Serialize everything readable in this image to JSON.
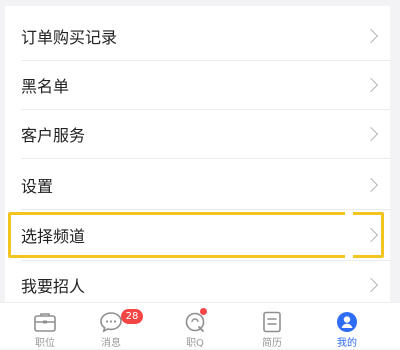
{
  "menu": {
    "items": [
      {
        "label": "订单购买记录"
      },
      {
        "label": "黑名单"
      },
      {
        "label": "客户服务"
      },
      {
        "label": "设置"
      },
      {
        "label": "选择频道"
      },
      {
        "label": "我要招人"
      }
    ]
  },
  "tabbar": {
    "tabs": [
      {
        "label": "职位",
        "icon": "briefcase-icon"
      },
      {
        "label": "消息",
        "icon": "chat-bubble-icon"
      },
      {
        "label": "职Q",
        "icon": "q-bubble-icon"
      },
      {
        "label": "简历",
        "icon": "resume-icon"
      },
      {
        "label": "我的",
        "icon": "user-avatar-icon"
      }
    ],
    "message_badge": "28",
    "active_tab": "我的"
  },
  "colors": {
    "highlight": "#f2c41f",
    "active_tab": "#2f6df6",
    "badge": "#f24646"
  }
}
